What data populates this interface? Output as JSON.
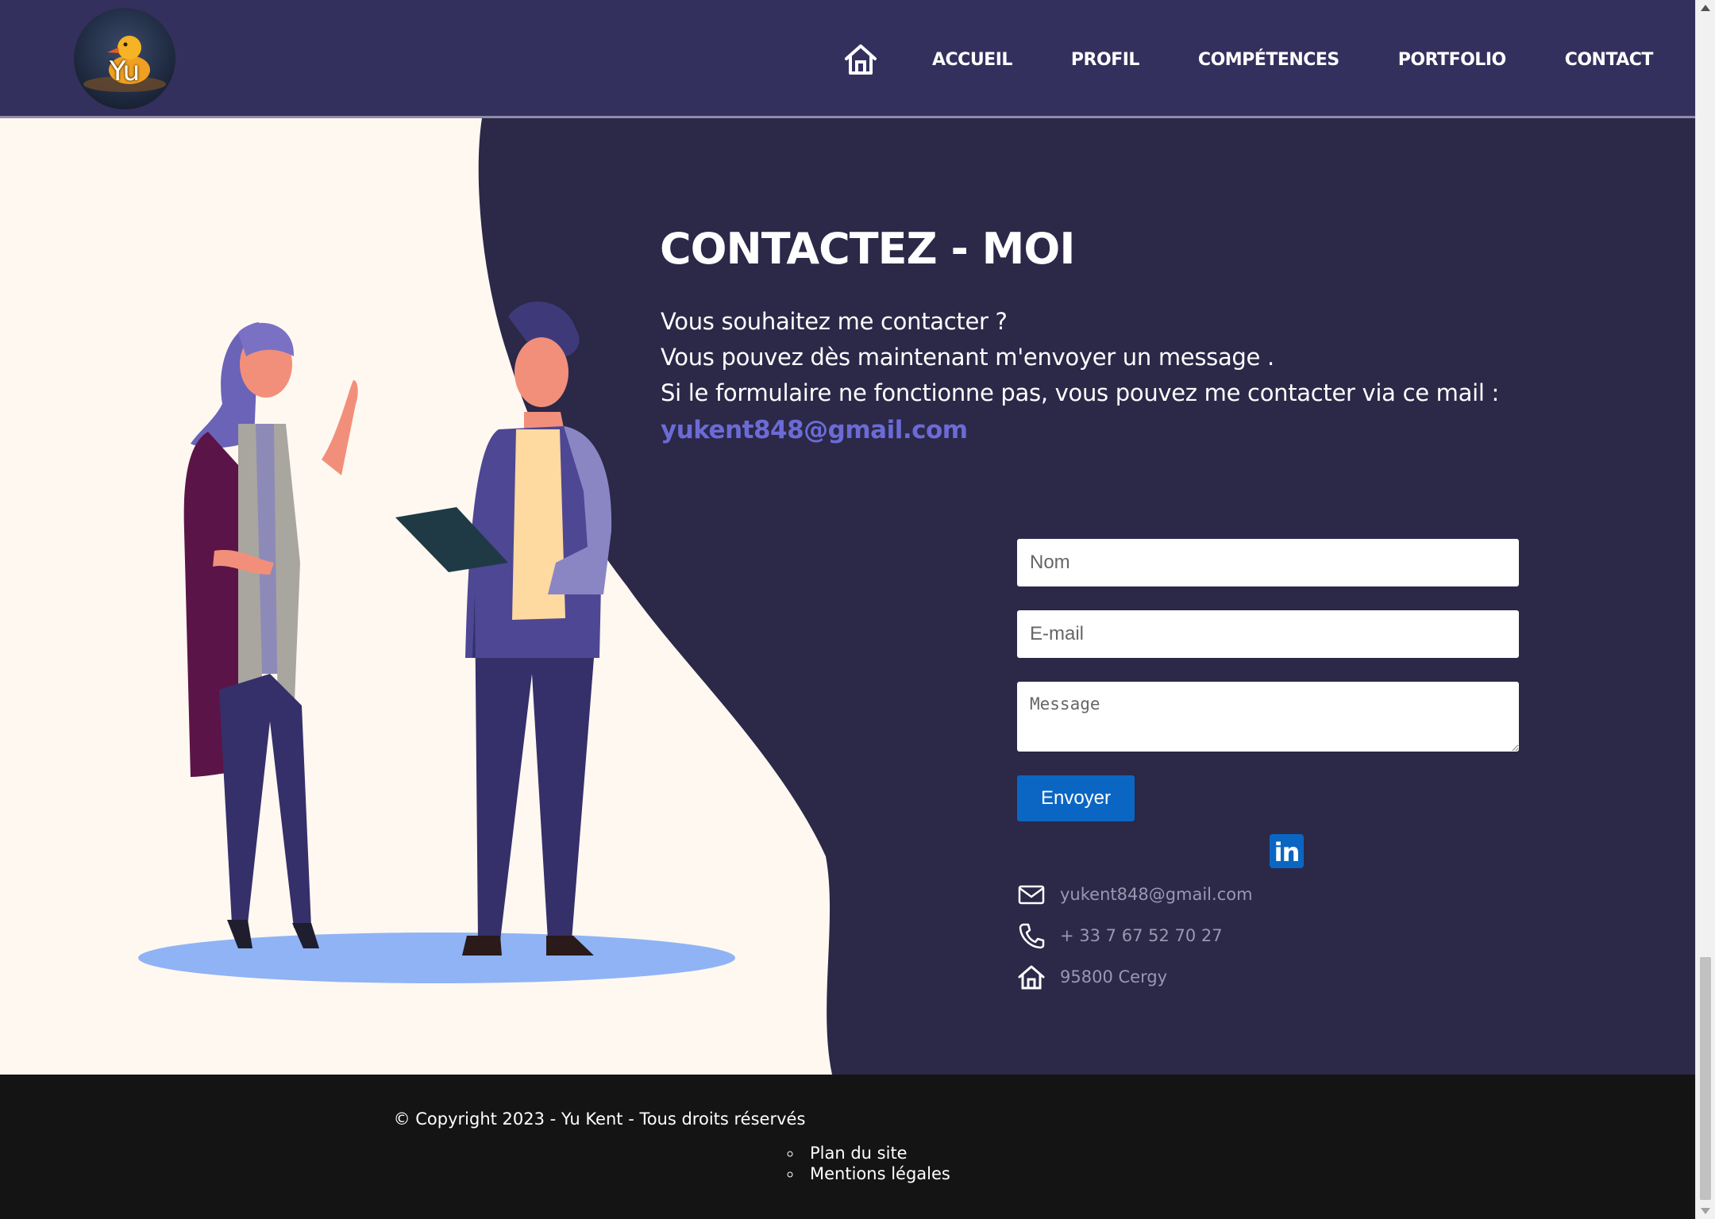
{
  "header": {
    "logo_text": "Yu",
    "nav": {
      "home_icon": "home-icon",
      "items": [
        "ACCUEIL",
        "PROFIL",
        "COMPÉTENCES",
        "PORTFOLIO",
        "CONTACT"
      ]
    }
  },
  "contact": {
    "title": "CONTACTEZ - MOI",
    "intro_lines": [
      "Vous souhaitez me contacter ?",
      "Vous pouvez dès maintenant m'envoyer un message .",
      "Si le formulaire ne fonctionne pas, vous pouvez me contacter via ce mail :"
    ],
    "email_link": "yukent848@gmail.com",
    "form": {
      "name_placeholder": "Nom",
      "email_placeholder": "E-mail",
      "message_placeholder": "Message",
      "submit_label": "Envoyer"
    },
    "info": {
      "email": "yukent848@gmail.com",
      "phone": "+ 33 7 67 52 70 27",
      "address": "95800 Cergy",
      "email_icon": "mail-icon",
      "phone_icon": "phone-icon",
      "address_icon": "home-icon",
      "linkedin_label": "in"
    }
  },
  "footer": {
    "copyright": "© Copyright 2023 - Yu Kent - Tous droits réservés",
    "links": [
      "Plan du site",
      "Mentions légales"
    ]
  },
  "colors": {
    "header_bg": "#34305e",
    "main_bg": "#2b2848",
    "cream": "#fef8f1",
    "accent_link": "#6b6bd6",
    "button": "#0a66c2",
    "footer_bg": "#141414"
  }
}
